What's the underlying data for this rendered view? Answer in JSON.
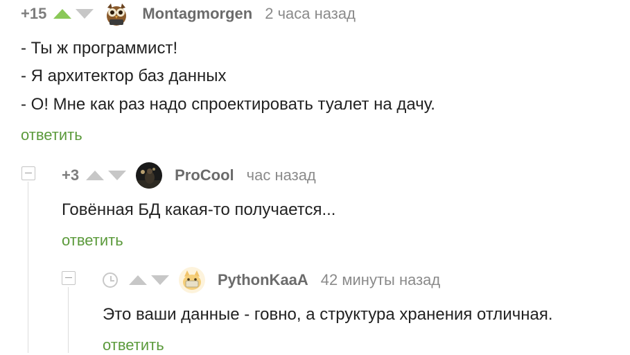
{
  "comments": [
    {
      "rating": "+15",
      "username": "Montagmorgen",
      "time": "2 часа назад",
      "lines": [
        "- Ты ж программист!",
        "- Я архитектор баз данных",
        "- О! Мне как раз надо спроектировать туалет на дачу."
      ],
      "reply_label": "ответить"
    },
    {
      "rating": "+3",
      "username": "ProCool",
      "time": "час назад",
      "lines": [
        "Говённая БД какая-то получается..."
      ],
      "reply_label": "ответить"
    },
    {
      "rating": "",
      "username": "PythonKaaA",
      "time": "42 минуты назад",
      "lines": [
        "Это ваши данные - говно, а структура хранения отличная."
      ],
      "reply_label": "ответить"
    }
  ],
  "colors": {
    "upvote_active": "#8ac858",
    "vote_inactive": "#c7c7c7",
    "reply_link": "#5b9a3b",
    "username": "#6b6b6b",
    "timestamp": "#8a8a8a"
  },
  "icons": {
    "upvote": "triangle-up-icon",
    "downvote": "triangle-down-icon",
    "collapse": "minus-square-icon",
    "rating_hidden": "clock-icon"
  }
}
